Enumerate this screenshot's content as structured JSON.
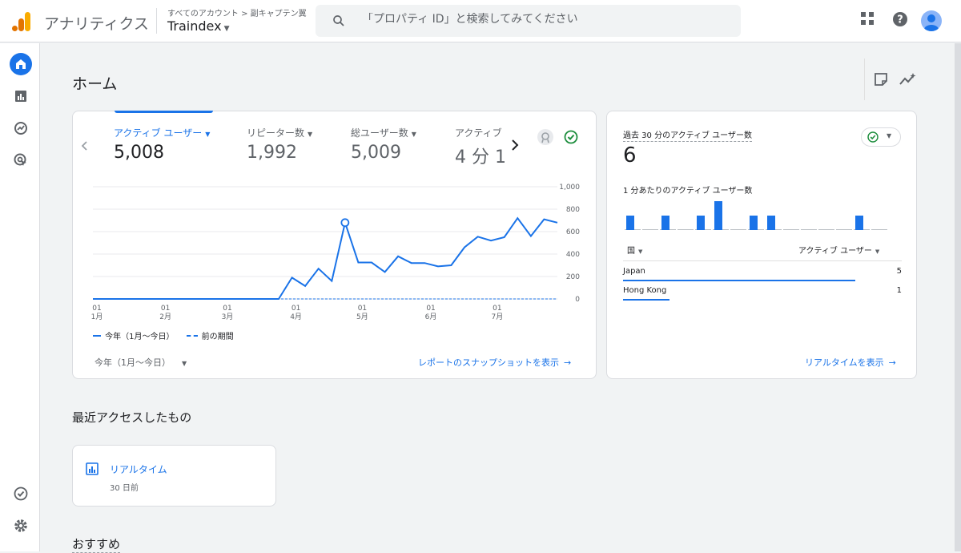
{
  "header": {
    "app_title": "アナリティクス",
    "breadcrumb": "すべてのアカウント > 副キャプテン翼",
    "property": "Traindex",
    "search_placeholder": "「プロパティ ID」と検索してみてください"
  },
  "page": {
    "title": "ホーム"
  },
  "metrics": [
    {
      "label": "アクティブ ユーザー",
      "value": "5,008"
    },
    {
      "label": "リピーター数",
      "value": "1,992"
    },
    {
      "label": "総ユーザー数",
      "value": "5,009"
    },
    {
      "label": "アクティブ",
      "value": "4 分 1"
    }
  ],
  "chart_data": {
    "type": "line",
    "x_tick_labels": [
      [
        "01",
        "1月"
      ],
      [
        "01",
        "2月"
      ],
      [
        "01",
        "3月"
      ],
      [
        "01",
        "4月"
      ],
      [
        "01",
        "5月"
      ],
      [
        "01",
        "6月"
      ],
      [
        "01",
        "7月"
      ]
    ],
    "y_tick_labels": [
      "0",
      "200",
      "400",
      "600",
      "800",
      "1,000"
    ],
    "ylim": [
      0,
      1000
    ],
    "series": [
      {
        "name": "今年（1月〜今日）",
        "style": "solid",
        "values": [
          0,
          0,
          0,
          0,
          0,
          0,
          0,
          0,
          0,
          0,
          0,
          0,
          0,
          0,
          0,
          190,
          115,
          270,
          160,
          680,
          325,
          325,
          240,
          380,
          320,
          320,
          290,
          300,
          460,
          555,
          520,
          550,
          720,
          560,
          710,
          680
        ]
      },
      {
        "name": "前の期間",
        "style": "dashed",
        "values": [
          0,
          0,
          0,
          0,
          0,
          0,
          0,
          0,
          0,
          0,
          0,
          0,
          0,
          0,
          0,
          0,
          0,
          0,
          0,
          0,
          0,
          0,
          0,
          0,
          0,
          0,
          0,
          0,
          0,
          0,
          0,
          0,
          0,
          0,
          0,
          0
        ]
      }
    ],
    "highlight_index": 19
  },
  "main_card": {
    "date_range": "今年（1月〜今日）",
    "snapshot_link": "レポートのスナップショットを表示"
  },
  "realtime": {
    "title": "過去 30 分のアクティブ ユーザー数",
    "value": "6",
    "per_minute_label": "1 分あたりのアクティブ ユーザー数",
    "per_minute_values": [
      2,
      0,
      2,
      0,
      2,
      4,
      0,
      2,
      2,
      0,
      0,
      0,
      0,
      2,
      0
    ],
    "col_country": "国",
    "col_users": "アクティブ ユーザー",
    "rows": [
      {
        "country": "Japan",
        "users": "5",
        "share": 1.0
      },
      {
        "country": "Hong Kong",
        "users": "1",
        "share": 0.2
      }
    ],
    "link": "リアルタイムを表示"
  },
  "recent": {
    "section_title": "最近アクセスしたもの",
    "item_title": "リアルタイム",
    "item_time": "30 日前"
  },
  "recommend": {
    "section_title": "おすすめ"
  },
  "colors": {
    "accent": "#1a73e8",
    "logo_orange": "#f9ab00",
    "logo_dark": "#e37400",
    "check_green": "#1e8e3e"
  }
}
